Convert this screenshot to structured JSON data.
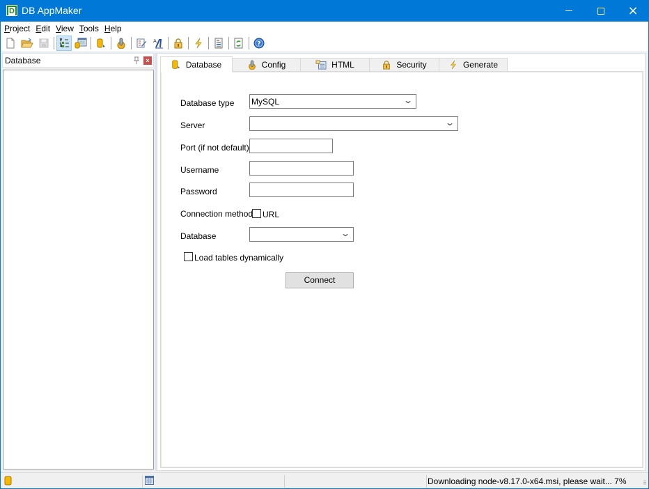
{
  "window": {
    "title": "DB AppMaker",
    "app_icon_letter": "D",
    "controls": {
      "minimize": "minimize",
      "maximize": "maximize",
      "close": "×"
    }
  },
  "menubar": {
    "items": [
      {
        "label": "Project",
        "accel": "P"
      },
      {
        "label": "Edit",
        "accel": "E"
      },
      {
        "label": "View",
        "accel": "V"
      },
      {
        "label": "Tools",
        "accel": "T"
      },
      {
        "label": "Help",
        "accel": "H"
      }
    ]
  },
  "toolbar": {
    "buttons": [
      {
        "icon": "new-file-icon",
        "enabled": true
      },
      {
        "icon": "open-folder-icon",
        "enabled": true
      },
      {
        "icon": "save-icon",
        "enabled": false
      },
      {
        "icon": "tree-view-icon",
        "enabled": true,
        "pressed": true
      },
      {
        "icon": "table-view-icon",
        "enabled": true
      },
      {
        "icon": "database-icon",
        "enabled": true
      },
      {
        "icon": "config-icon",
        "enabled": true
      },
      {
        "icon": "edit-icon",
        "enabled": true
      },
      {
        "icon": "font-icon",
        "enabled": true
      },
      {
        "icon": "lock-icon",
        "enabled": true
      },
      {
        "icon": "lightning-icon",
        "enabled": true
      },
      {
        "icon": "form-icon",
        "enabled": true
      },
      {
        "icon": "refresh-icon",
        "enabled": true
      },
      {
        "icon": "help-icon",
        "enabled": true
      }
    ]
  },
  "left_panel": {
    "title": "Database",
    "pin_icon": "pin-icon",
    "close_icon": "×"
  },
  "tabs": [
    {
      "label": "Database",
      "icon": "database-icon",
      "selected": true
    },
    {
      "label": "Config",
      "icon": "config-icon",
      "selected": false
    },
    {
      "label": "HTML",
      "icon": "html-icon",
      "selected": false
    },
    {
      "label": "Security",
      "icon": "lock-icon",
      "selected": false
    },
    {
      "label": "Generate",
      "icon": "lightning-icon",
      "selected": false
    }
  ],
  "form": {
    "database_type": {
      "label": "Database type",
      "value": "MySQL"
    },
    "server": {
      "label": "Server",
      "value": ""
    },
    "port": {
      "label": "Port (if not default)",
      "value": ""
    },
    "username": {
      "label": "Username",
      "value": ""
    },
    "password": {
      "label": "Password",
      "value": ""
    },
    "connection_method": {
      "label": "Connection method",
      "option_label": "URL",
      "checked": false
    },
    "database": {
      "label": "Database",
      "value": ""
    },
    "load_tables": {
      "label": "Load tables dynamically",
      "checked": false
    },
    "connect_button": "Connect",
    "chevron": "⌄"
  },
  "statusbar": {
    "message": "Downloading node-v8.17.0-x64.msi, please wait... 7%",
    "progress_percent": 7
  }
}
